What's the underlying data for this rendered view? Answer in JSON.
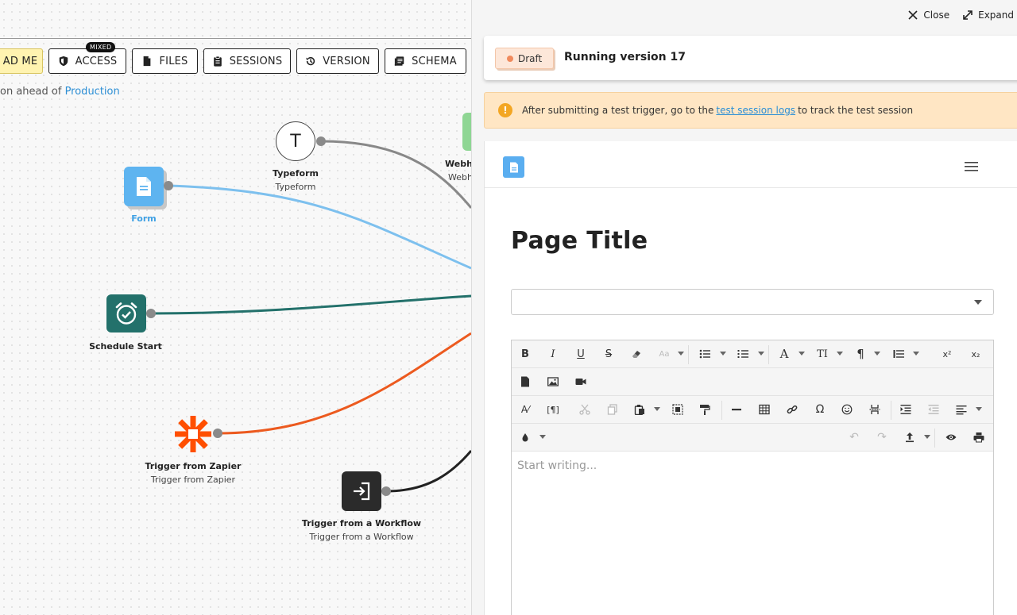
{
  "toolbar": {
    "readme_label": "AD ME",
    "access_label": "ACCESS",
    "access_badge": "MIXED",
    "files_label": "FILES",
    "sessions_label": "SESSIONS",
    "version_label": "VERSION",
    "schema_label": "SCHEMA"
  },
  "version_note": {
    "prefix": "on ahead of",
    "link": "Production"
  },
  "nodes": {
    "typeform": {
      "title": "Typeform",
      "subtitle": "Typeform",
      "glyph": "T"
    },
    "webhook": {
      "title": "Webh",
      "subtitle": "Webh"
    },
    "form": {
      "title": "Form"
    },
    "schedule": {
      "title": "Schedule Start"
    },
    "zapier": {
      "title": "Trigger from Zapier",
      "subtitle": "Trigger from Zapier"
    },
    "workflow": {
      "title": "Trigger from a Workflow",
      "subtitle": "Trigger from a Workflow"
    }
  },
  "panel": {
    "close_label": "Close",
    "expand_label": "Expand",
    "draft_label": "Draft",
    "running_title": "Running version 17",
    "warning": {
      "before": "After submitting a test trigger, go to the",
      "link": "test session logs",
      "after": "to track the test session"
    },
    "page_title": "Page Title",
    "editor_placeholder": "Start writing..."
  },
  "colors": {
    "wire_form": "#7dc0ee",
    "wire_schedule": "#23716b",
    "wire_zapier": "#ec5a1f",
    "wire_workflow": "#222222",
    "wire_typeform": "#888888",
    "accent_blue": "#2d8fd5"
  }
}
